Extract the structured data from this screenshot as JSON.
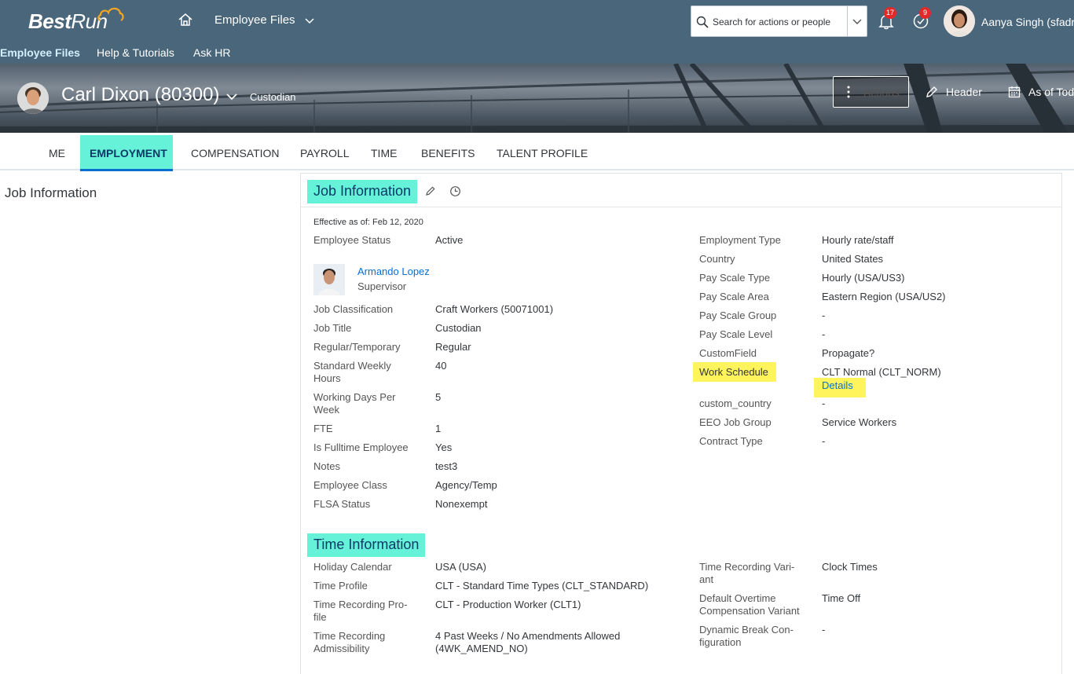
{
  "shell": {
    "logo_best": "Best",
    "logo_run": "Run",
    "title": "Employee Files",
    "search_placeholder": "Search for actions or people",
    "notifications_count": "17",
    "tasks_count": "9",
    "user_name": "Aanya Singh (sfadm"
  },
  "subnav": {
    "items": [
      "Employee Files",
      "Help & Tutorials",
      "Ask HR"
    ]
  },
  "employee": {
    "name": "Carl Dixon (80300)",
    "title": "Custodian",
    "actions_label": "Actions",
    "header_label": "Header",
    "asof_label": "As of Tod"
  },
  "tabs": [
    "ME",
    "EMPLOYMENT",
    "COMPENSATION",
    "PAYROLL",
    "TIME",
    "BENEFITS",
    "TALENT PROFILE"
  ],
  "left_nav": {
    "title": "Job Information"
  },
  "job_info": {
    "heading": "Job Information",
    "effective": "Effective as of: Feb 12, 2020",
    "supervisor_name": "Armando Lopez",
    "supervisor_role": "Supervisor",
    "left": [
      {
        "label": "Employee Status",
        "value": "Active"
      },
      {
        "label": "Job Classification",
        "value": "Craft Workers (50071001)"
      },
      {
        "label": "Job Title",
        "value": "Custodian"
      },
      {
        "label": "Regular/Temporary",
        "value": "Regular"
      },
      {
        "label": "Standard Weekly Hours",
        "value": "40"
      },
      {
        "label": "Working Days Per Week",
        "value": "5"
      },
      {
        "label": "FTE",
        "value": "1"
      },
      {
        "label": "Is Fulltime Employee",
        "value": "Yes"
      },
      {
        "label": "Notes",
        "value": "test3"
      },
      {
        "label": "Employee Class",
        "value": "Agency/Temp"
      },
      {
        "label": "FLSA Status",
        "value": "Nonexempt"
      }
    ],
    "right": [
      {
        "label": "Employment Type",
        "value": "Hourly rate/staff"
      },
      {
        "label": "Country",
        "value": "United States"
      },
      {
        "label": "Pay Scale Type",
        "value": "Hourly (USA/US3)"
      },
      {
        "label": "Pay Scale Area",
        "value": "Eastern Region (USA/US2)"
      },
      {
        "label": "Pay Scale Group",
        "value": "-"
      },
      {
        "label": "Pay Scale Level",
        "value": "-"
      },
      {
        "label": "CustomField",
        "value": "Propagate?"
      },
      {
        "label": "Work Schedule",
        "value": "CLT Normal (CLT_NORM)"
      },
      {
        "label": "custom_country",
        "value": "-"
      },
      {
        "label": "EEO Job Group",
        "value": "Service Workers"
      },
      {
        "label": "Contract Type",
        "value": "-"
      }
    ],
    "details_link": "Details"
  },
  "time_info": {
    "heading": "Time Information",
    "left": [
      {
        "label": "Holiday Calendar",
        "value": "USA (USA)"
      },
      {
        "label": "Time Profile",
        "value": "CLT - Standard Time Types (CLT_STANDARD)"
      },
      {
        "label": "Time Recording Pro-file",
        "value": "CLT - Production Worker (CLT1)"
      },
      {
        "label": "Time Recording Admissibility",
        "value": "4 Past Weeks / No Amendments Allowed (4WK_AMEND_NO)"
      }
    ],
    "right": [
      {
        "label": "Time Recording Vari-ant",
        "value": "Clock Times"
      },
      {
        "label": "Default Overtime Compensation Variant",
        "value": "Time Off"
      },
      {
        "label": "Dynamic Break Con-figuration",
        "value": "-"
      }
    ]
  }
}
